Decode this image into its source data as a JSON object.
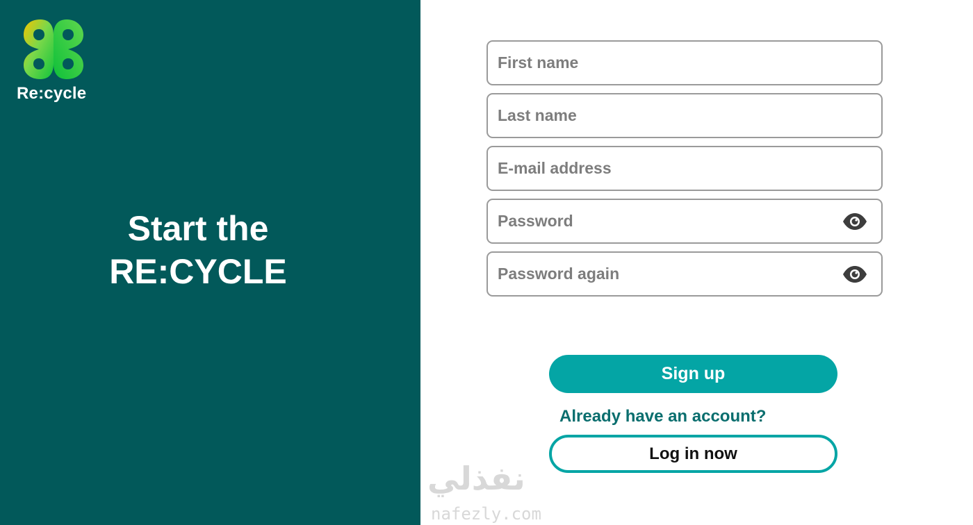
{
  "brand": {
    "name": "Re:cycle",
    "logo_icon": "infinity-loop-logo",
    "colors": {
      "panel": "#02595a",
      "accent": "#04a5a5",
      "logo_green": "#22c55e",
      "logo_yellow": "#f5c400"
    }
  },
  "hero": {
    "line1": "Start the",
    "line2": "RE:CYCLE"
  },
  "form": {
    "first_name": {
      "placeholder": "First name",
      "value": ""
    },
    "last_name": {
      "placeholder": "Last name",
      "value": ""
    },
    "email": {
      "placeholder": "E-mail address",
      "value": ""
    },
    "password": {
      "placeholder": "Password",
      "value": "",
      "icon": "eye-icon"
    },
    "password_again": {
      "placeholder": "Password again",
      "value": "",
      "icon": "eye-icon"
    }
  },
  "actions": {
    "signup_label": "Sign up",
    "already_text": "Already have an account?",
    "login_label": "Log in now"
  },
  "watermark": {
    "arabic": "نفذلي",
    "latin": "nafezly.com"
  }
}
